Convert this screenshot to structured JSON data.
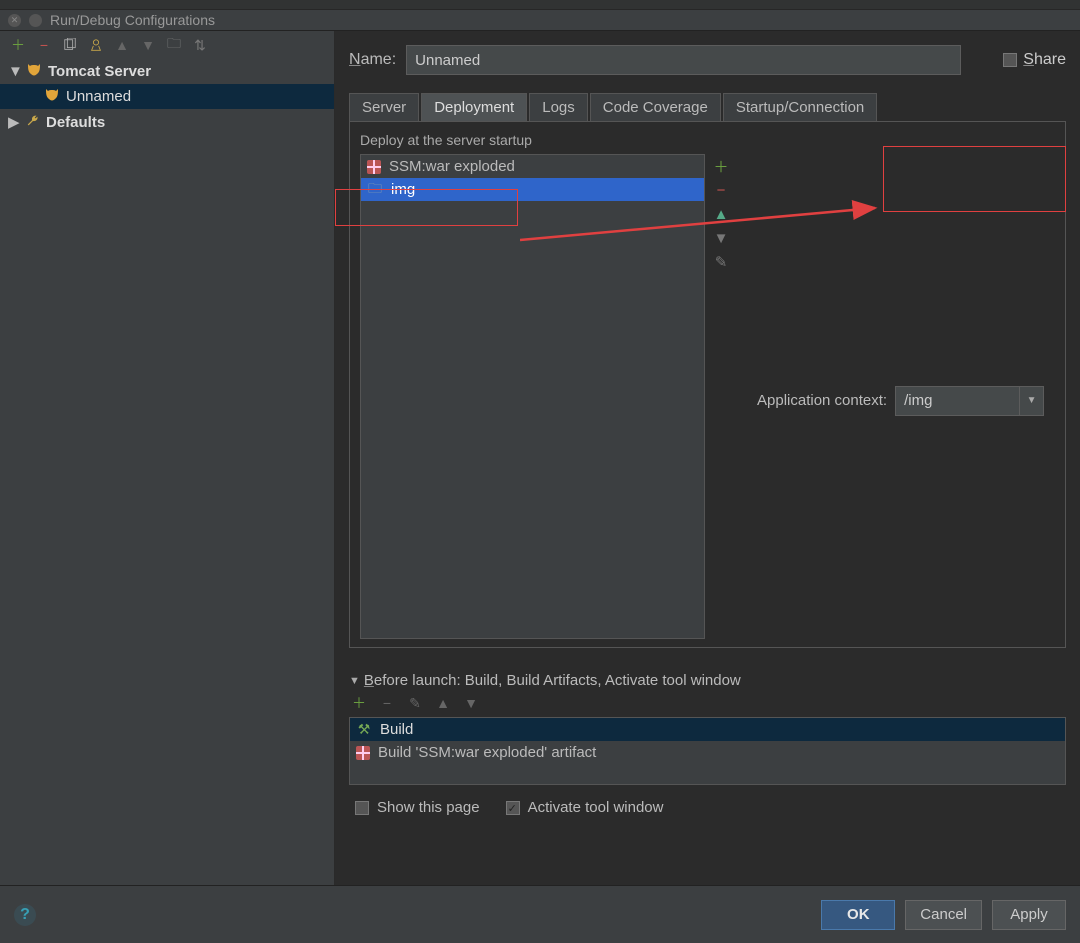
{
  "window": {
    "title": "Run/Debug Configurations"
  },
  "sidebar": {
    "nodes": [
      {
        "label": "Tomcat Server",
        "children": [
          {
            "label": "Unnamed"
          }
        ]
      },
      {
        "label": "Defaults"
      }
    ]
  },
  "form": {
    "name_label": "Name:",
    "name_value": "Unnamed",
    "share_label": "Share"
  },
  "tabs": [
    "Server",
    "Deployment",
    "Logs",
    "Code Coverage",
    "Startup/Connection"
  ],
  "active_tab": "Deployment",
  "deploy": {
    "section_label": "Deploy at the server startup",
    "items": [
      {
        "icon": "artifact",
        "label": "SSM:war exploded"
      },
      {
        "icon": "folder",
        "label": "img"
      }
    ],
    "context_label": "Application context:",
    "context_value": "/img"
  },
  "before_launch": {
    "header": "Before launch: Build, Build Artifacts, Activate tool window",
    "tasks": [
      {
        "icon": "hammer",
        "label": "Build"
      },
      {
        "icon": "artifact",
        "label": "Build 'SSM:war exploded' artifact"
      }
    ],
    "show_label": "Show this page",
    "activate_label": "Activate tool window"
  },
  "buttons": {
    "ok": "OK",
    "cancel": "Cancel",
    "apply": "Apply"
  }
}
